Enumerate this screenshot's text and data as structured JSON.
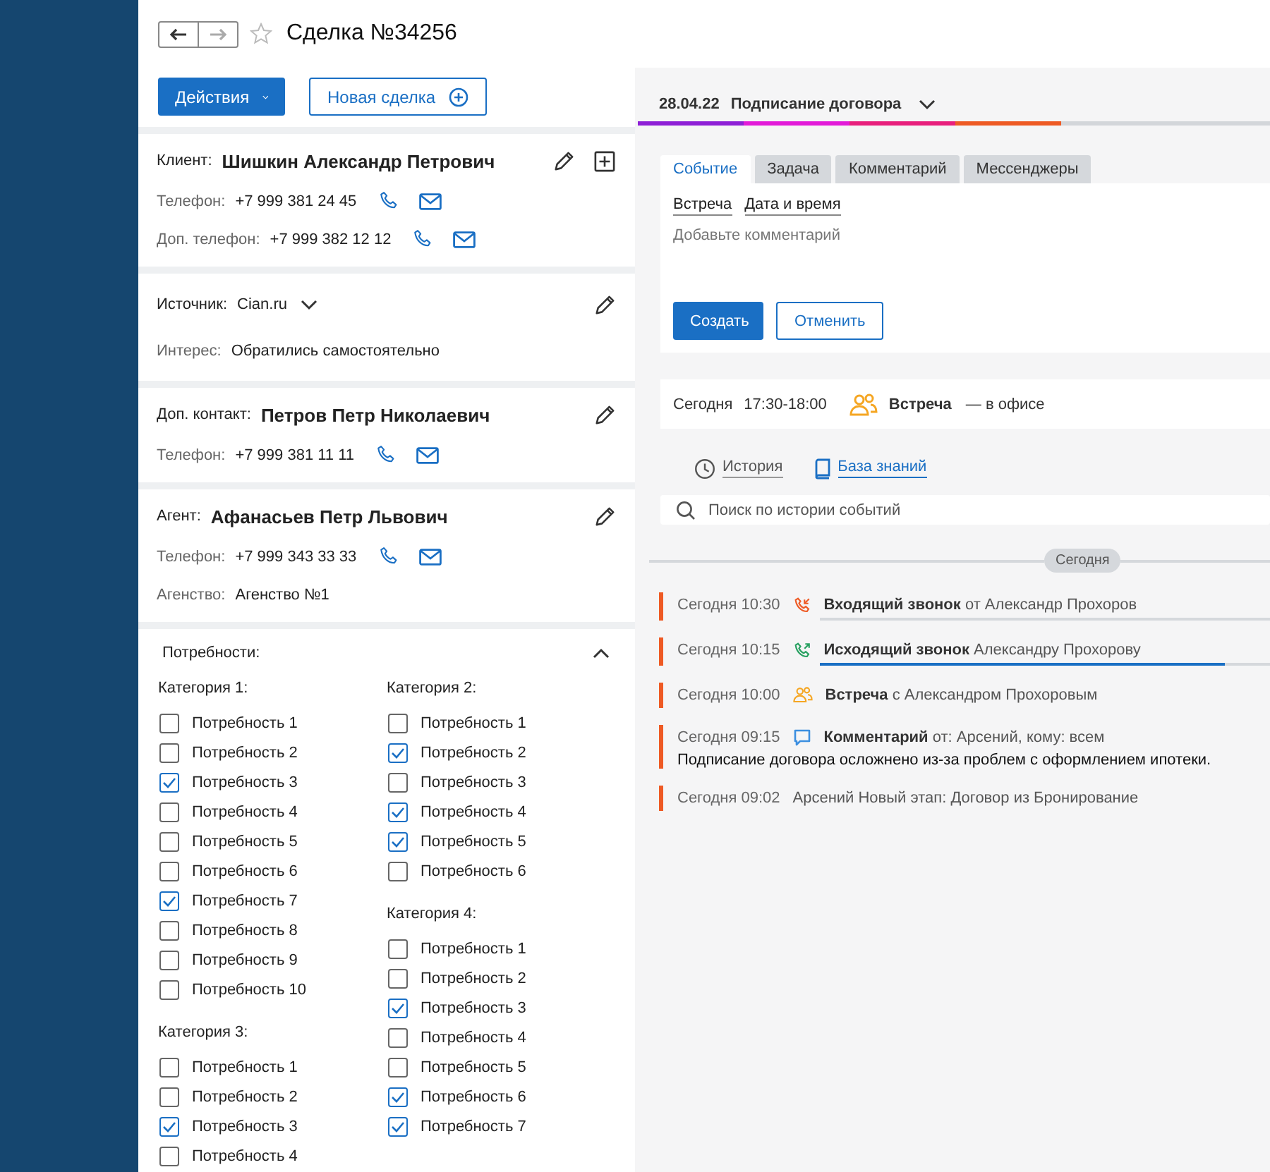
{
  "header": {
    "title": "Сделка №34256"
  },
  "actions": {
    "primary": "Действия",
    "secondary": "Новая сделка"
  },
  "client": {
    "label": "Клиент:",
    "name": "Шишкин Александр Петрович",
    "phones": [
      {
        "label": "Телефон:",
        "value": "+7 999 381 24 45"
      },
      {
        "label": "Доп. телефон:",
        "value": "+7 999 382 12 12"
      }
    ]
  },
  "source": {
    "label": "Источник:",
    "value": "Cian.ru",
    "interest_label": "Интерес:",
    "interest": "Обратились самостоятельно"
  },
  "extra_contact": {
    "label": "Доп. контакт:",
    "name": "Петров Петр Николаевич",
    "phones": [
      {
        "label": "Телефон:",
        "value": "+7 999 381 11 11"
      }
    ]
  },
  "agent": {
    "label": "Агент:",
    "name": "Афанасьев Петр Львович",
    "phones": [
      {
        "label": "Телефон:",
        "value": "+7 999 343 33 33"
      }
    ],
    "agency_label": "Агенство:",
    "agency": "Агенство №1"
  },
  "needs": {
    "title": "Потребности:",
    "expanded": true,
    "columns": [
      [
        {
          "title": "Категория 1:",
          "items": [
            {
              "label": "Потребность 1",
              "checked": false
            },
            {
              "label": "Потребность 2",
              "checked": false
            },
            {
              "label": "Потребность 3",
              "checked": true
            },
            {
              "label": "Потребность 4",
              "checked": false
            },
            {
              "label": "Потребность 5",
              "checked": false
            },
            {
              "label": "Потребность 6",
              "checked": false
            },
            {
              "label": "Потребность 7",
              "checked": true
            },
            {
              "label": "Потребность 8",
              "checked": false
            },
            {
              "label": "Потребность 9",
              "checked": false
            },
            {
              "label": "Потребность 10",
              "checked": false
            }
          ]
        },
        {
          "title": "Категория 3:",
          "items": [
            {
              "label": "Потребность 1",
              "checked": false
            },
            {
              "label": "Потребность 2",
              "checked": false
            },
            {
              "label": "Потребность 3",
              "checked": true
            },
            {
              "label": "Потребность 4",
              "checked": false
            }
          ]
        }
      ],
      [
        {
          "title": "Категория 2:",
          "items": [
            {
              "label": "Потребность 1",
              "checked": false
            },
            {
              "label": "Потребность 2",
              "checked": true
            },
            {
              "label": "Потребность 3",
              "checked": false
            },
            {
              "label": "Потребность 4",
              "checked": true
            },
            {
              "label": "Потребность 5",
              "checked": true
            },
            {
              "label": "Потребность 6",
              "checked": false
            }
          ]
        },
        {
          "title": "Категория 4:",
          "items": [
            {
              "label": "Потребность 1",
              "checked": false
            },
            {
              "label": "Потребность 2",
              "checked": false
            },
            {
              "label": "Потребность 3",
              "checked": true
            },
            {
              "label": "Потребность 4",
              "checked": false
            },
            {
              "label": "Потребность 5",
              "checked": false
            },
            {
              "label": "Потребность 6",
              "checked": true
            },
            {
              "label": "Потребность 7",
              "checked": true
            }
          ]
        }
      ]
    ]
  },
  "stage": {
    "date": "28.04.22",
    "name": "Подписание договора",
    "segments": [
      {
        "color": "#8e1fd6"
      },
      {
        "color": "#e21ad8"
      },
      {
        "color": "#e81f7c"
      },
      {
        "color": "#ee5a24"
      },
      {
        "color": "#d3d6da"
      }
    ]
  },
  "event_form": {
    "tabs": [
      {
        "label": "Событие",
        "selected": true
      },
      {
        "label": "Задача",
        "selected": false
      },
      {
        "label": "Комментарий",
        "selected": false
      },
      {
        "label": "Мессенджеры",
        "selected": false
      }
    ],
    "fields": [
      "Встреча",
      "Дата и время"
    ],
    "placeholder": "Добавьте комментарий",
    "create": "Создать",
    "cancel": "Отменить"
  },
  "upcoming": {
    "day": "Сегодня",
    "time": "17:30-18:00",
    "title": "Встреча",
    "note": "— в офисе"
  },
  "links": [
    {
      "kind": "history",
      "label": "История",
      "selected": false
    },
    {
      "kind": "knowledge",
      "label": "База знаний",
      "selected": true
    }
  ],
  "search": {
    "placeholder": "Поиск по истории событий"
  },
  "day_divider": "Сегодня",
  "events": [
    {
      "kind": "incoming_call",
      "time": "Сегодня 10:30",
      "text": "**Входящий звонок** от Александр Прохоров"
    },
    {
      "kind": "outgoing_call",
      "time": "Сегодня 10:15",
      "text": "**Исходящий звонок** Александру Прохорову",
      "level": 0.9
    },
    {
      "kind": "meeting",
      "time": "Сегодня 10:00",
      "text": "**Встреча** с Александром Прохоровым"
    },
    {
      "kind": "comment",
      "time": "Сегодня 09:15",
      "text": "**Комментарий** от: Арсений, кому: всем",
      "body": "Подписание договора осложнено из-за проблем с оформлением ипотеки."
    },
    {
      "kind": "stage",
      "time": "Сегодня 09:02",
      "text": "Арсений Новый этап: Договор из Бронирование"
    }
  ]
}
